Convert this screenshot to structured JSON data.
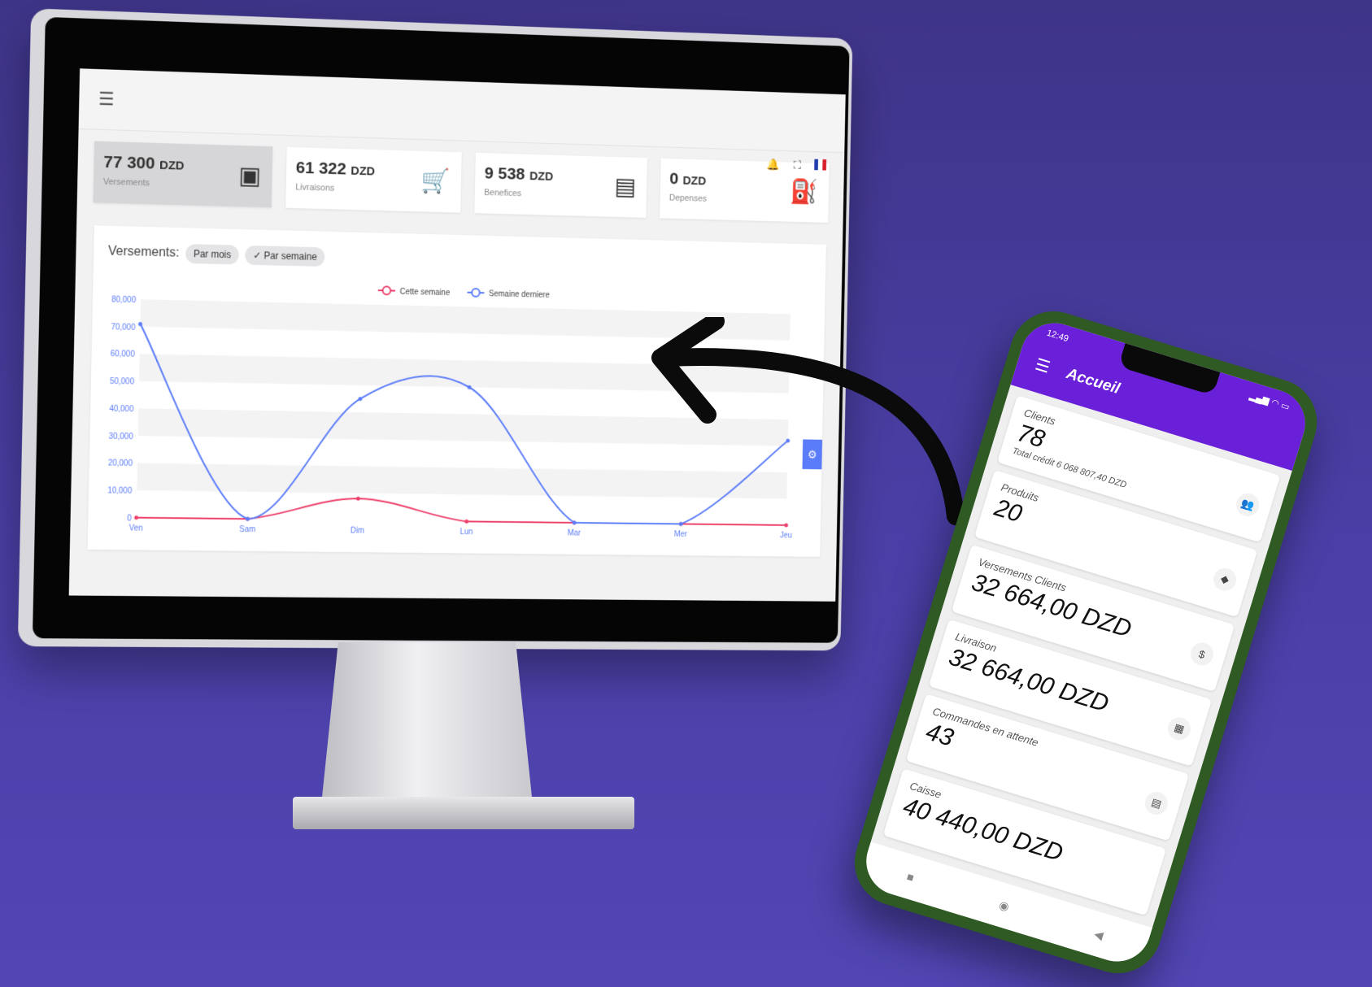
{
  "desktop": {
    "stats": [
      {
        "value": "77 300",
        "unit": "DZD",
        "label": "Versements",
        "icon": "wallet-icon"
      },
      {
        "value": "61 322",
        "unit": "DZD",
        "label": "Livraisons",
        "icon": "cart-icon"
      },
      {
        "value": "9 538",
        "unit": "DZD",
        "label": "Benefices",
        "icon": "store-icon"
      },
      {
        "value": "0",
        "unit": "DZD",
        "label": "Depenses",
        "icon": "fuel-icon"
      }
    ],
    "chart_title": "Versements:",
    "chips": [
      "Par mois",
      "Par semaine"
    ],
    "selected_chip": "Par semaine",
    "chip_check": "✓"
  },
  "chart_data": {
    "type": "line",
    "categories": [
      "Ven",
      "Sam",
      "Dim",
      "Lun",
      "Mar",
      "Mer",
      "Jeu"
    ],
    "series": [
      {
        "name": "Cette semaine",
        "color": "#ee3f6a",
        "values": [
          0,
          0,
          8000,
          0,
          0,
          0,
          0
        ]
      },
      {
        "name": "Semaine derniere",
        "color": "#5b7cfa",
        "values": [
          71000,
          0,
          45000,
          50000,
          0,
          0,
          32000
        ]
      }
    ],
    "yticks": [
      "80,000",
      "70,000",
      "60,000",
      "50,000",
      "40,000",
      "30,000",
      "20,000",
      "10,000",
      "0"
    ],
    "ylim": [
      0,
      80000
    ],
    "grid": true,
    "legend_position": "top-center"
  },
  "phone": {
    "status_time": "12:49",
    "app_title": "Accueil",
    "cards": [
      {
        "label": "Clients",
        "value": "78",
        "sub": "Total crédit 6 068 807,40 DZD",
        "icon": "people-icon"
      },
      {
        "label": "Produits",
        "value": "20",
        "sub": "",
        "icon": "box-icon"
      },
      {
        "label": "Versements Clients",
        "value": "32 664,00 DZD",
        "sub": "",
        "icon": "payment-icon"
      },
      {
        "label": "Livraison",
        "value": "32 664,00 DZD",
        "sub": "",
        "icon": "delivery-icon"
      },
      {
        "label": "Commandes en attente",
        "value": "43",
        "sub": "",
        "icon": "clipboard-icon"
      },
      {
        "label": "Caisse",
        "value": "40 440,00 DZD",
        "sub": "",
        "icon": "cash-icon"
      }
    ]
  }
}
